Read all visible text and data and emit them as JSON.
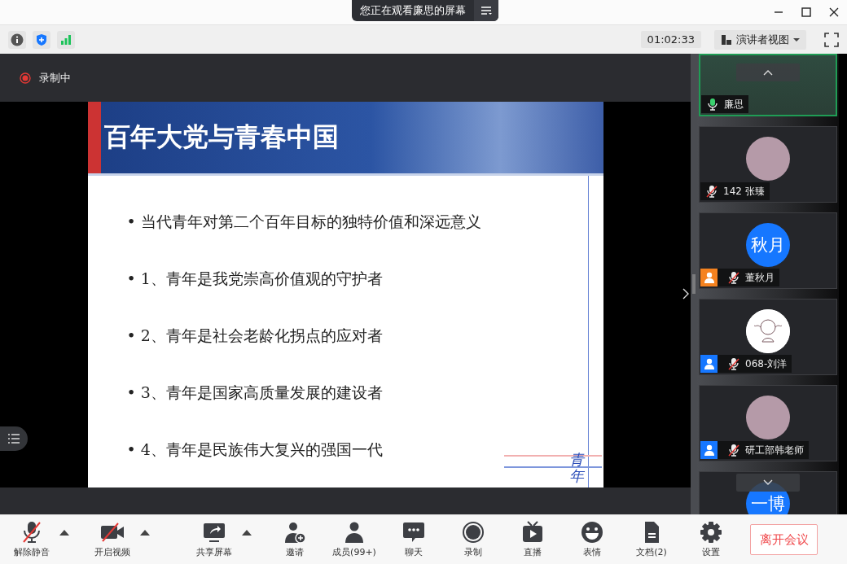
{
  "banner": {
    "text": "您正在观看廉思的屏幕"
  },
  "status_bar": {
    "timer": "01:02:33",
    "view_button": "演讲者视图"
  },
  "recording": {
    "label": "录制中"
  },
  "slide": {
    "title": "百年大党与青春中国",
    "bullets": [
      "• 当代青年对第二个百年目标的独特价值和深远意义",
      "• 1、青年是我党崇高价值观的守护者",
      "• 2、青年是社会老龄化拐点的应对者",
      "• 3、青年是国家高质量发展的建设者",
      "• 4、青年是民族伟大复兴的强国一代"
    ],
    "signature": "青年"
  },
  "participants": [
    {
      "name": "廉思",
      "kind": "video",
      "muted": false,
      "selected": true
    },
    {
      "name": "142 张臻",
      "kind": "photo",
      "muted": true,
      "selected": false
    },
    {
      "name": "董秋月",
      "kind": "initials",
      "avatar_text": "秋月",
      "muted": true,
      "selected": false,
      "color": "#f5821f"
    },
    {
      "name": "068-刘洋",
      "kind": "drawing",
      "muted": true,
      "selected": false,
      "color": "#1677ff"
    },
    {
      "name": "研工部韩老师",
      "kind": "photo",
      "muted": true,
      "selected": false,
      "color": "#1677ff"
    },
    {
      "kind": "initials",
      "avatar_text": "一博",
      "selected": false
    }
  ],
  "toolbar": [
    {
      "label": "解除静音",
      "kind": "mic",
      "caret": true
    },
    {
      "label": "开启视频",
      "kind": "video",
      "caret": true
    },
    {
      "label": "共享屏幕",
      "kind": "share",
      "caret": true
    },
    {
      "label": "邀请",
      "kind": "invite",
      "caret": false
    },
    {
      "label": "成员(99+)",
      "kind": "members",
      "caret": false
    },
    {
      "label": "聊天",
      "kind": "chat",
      "caret": false
    },
    {
      "label": "录制",
      "kind": "record",
      "caret": false
    },
    {
      "label": "直播",
      "kind": "live",
      "caret": false
    },
    {
      "label": "表情",
      "kind": "emoji",
      "caret": false
    },
    {
      "label": "文档(2)",
      "kind": "docs",
      "caret": false
    },
    {
      "label": "设置",
      "kind": "settings",
      "caret": false
    }
  ],
  "leave_button": "离开会议"
}
